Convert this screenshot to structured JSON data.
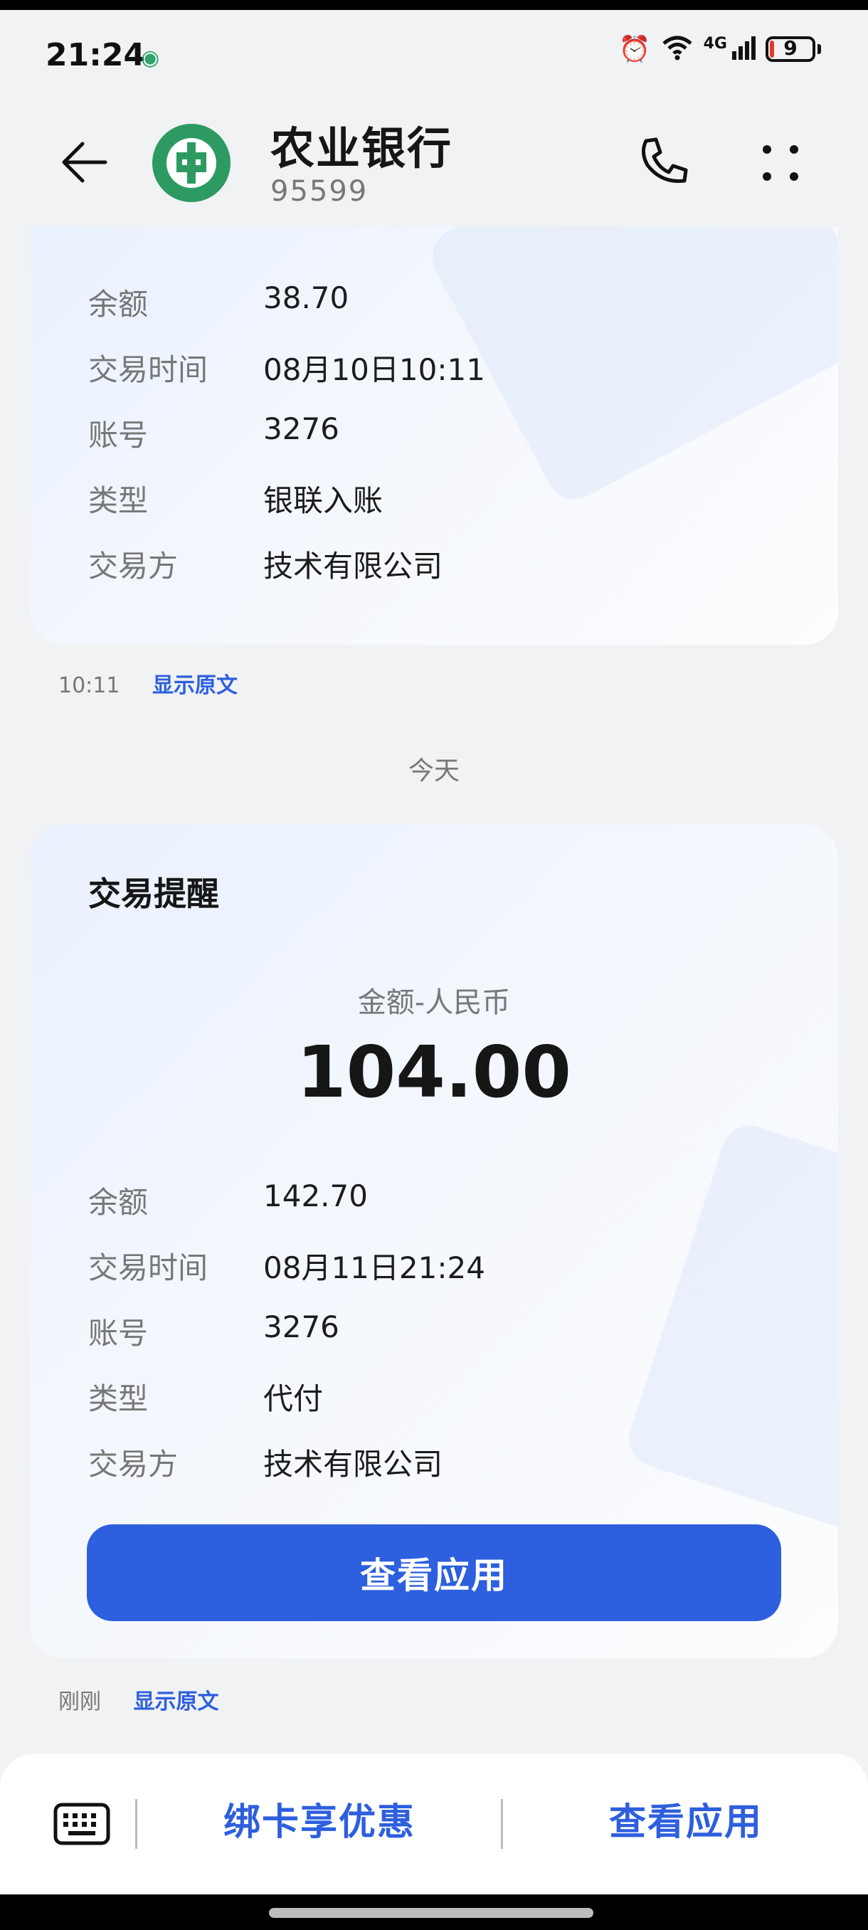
{
  "status_bar": {
    "time": "21:24",
    "network_label": "4G",
    "battery": "9"
  },
  "header": {
    "title": "农业银行",
    "subtitle": "95599"
  },
  "message1": {
    "rows": [
      {
        "label": "余额",
        "value": "38.70"
      },
      {
        "label": "交易时间",
        "value": "08月10日10:11"
      },
      {
        "label": "账号",
        "value": "3276"
      },
      {
        "label": "类型",
        "value": "银联入账"
      },
      {
        "label": "交易方",
        "value": "技术有限公司"
      }
    ],
    "time": "10:11",
    "show_original": "显示原文"
  },
  "date_divider": "今天",
  "message2": {
    "title": "交易提醒",
    "amount_label": "金额-人民币",
    "amount": "104.00",
    "rows": [
      {
        "label": "余额",
        "value": "142.70"
      },
      {
        "label": "交易时间",
        "value": "08月11日21:24"
      },
      {
        "label": "账号",
        "value": "3276"
      },
      {
        "label": "类型",
        "value": "代付"
      },
      {
        "label": "交易方",
        "value": "技术有限公司"
      }
    ],
    "button": "查看应用",
    "time": "刚刚",
    "show_original": "显示原文"
  },
  "bottom_bar": {
    "action1": "绑卡享优惠",
    "action2": "查看应用"
  }
}
